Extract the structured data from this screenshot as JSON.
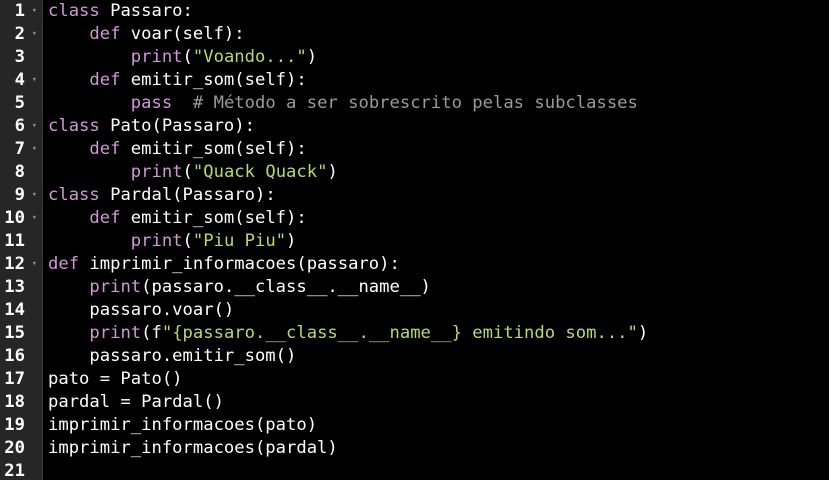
{
  "editor": {
    "colors": {
      "background": "#000000",
      "gutter": "#262626",
      "keyword": "#d197d9",
      "string": "#b8d96b",
      "comment": "#9a9a9a",
      "text": "#ffffff"
    },
    "fold_icon": "chevron-down-icon",
    "lines": [
      {
        "number": "1",
        "fold": true,
        "tokens": [
          {
            "t": "kw",
            "v": "class"
          },
          {
            "t": "plain",
            "v": " Passaro:"
          }
        ]
      },
      {
        "number": "2",
        "fold": true,
        "tokens": [
          {
            "t": "plain",
            "v": "    "
          },
          {
            "t": "kw",
            "v": "def"
          },
          {
            "t": "plain",
            "v": " voar(self):"
          }
        ]
      },
      {
        "number": "3",
        "fold": false,
        "tokens": [
          {
            "t": "plain",
            "v": "        "
          },
          {
            "t": "builtin",
            "v": "print"
          },
          {
            "t": "plain",
            "v": "("
          },
          {
            "t": "str",
            "v": "\"Voando...\""
          },
          {
            "t": "plain",
            "v": ")"
          }
        ]
      },
      {
        "number": "4",
        "fold": true,
        "tokens": [
          {
            "t": "plain",
            "v": "    "
          },
          {
            "t": "kw",
            "v": "def"
          },
          {
            "t": "plain",
            "v": " emitir_som(self):"
          }
        ]
      },
      {
        "number": "5",
        "fold": false,
        "tokens": [
          {
            "t": "plain",
            "v": "        "
          },
          {
            "t": "kw",
            "v": "pass"
          },
          {
            "t": "plain",
            "v": "  "
          },
          {
            "t": "comment",
            "v": "# Método a ser sobrescrito pelas subclasses"
          }
        ]
      },
      {
        "number": "6",
        "fold": true,
        "tokens": [
          {
            "t": "kw",
            "v": "class"
          },
          {
            "t": "plain",
            "v": " Pato(Passaro):"
          }
        ]
      },
      {
        "number": "7",
        "fold": true,
        "tokens": [
          {
            "t": "plain",
            "v": "    "
          },
          {
            "t": "kw",
            "v": "def"
          },
          {
            "t": "plain",
            "v": " emitir_som(self):"
          }
        ]
      },
      {
        "number": "8",
        "fold": false,
        "tokens": [
          {
            "t": "plain",
            "v": "        "
          },
          {
            "t": "builtin",
            "v": "print"
          },
          {
            "t": "plain",
            "v": "("
          },
          {
            "t": "str",
            "v": "\"Quack Quack\""
          },
          {
            "t": "plain",
            "v": ")"
          }
        ]
      },
      {
        "number": "9",
        "fold": true,
        "tokens": [
          {
            "t": "kw",
            "v": "class"
          },
          {
            "t": "plain",
            "v": " Pardal(Passaro):"
          }
        ]
      },
      {
        "number": "10",
        "fold": true,
        "tokens": [
          {
            "t": "plain",
            "v": "    "
          },
          {
            "t": "kw",
            "v": "def"
          },
          {
            "t": "plain",
            "v": " emitir_som(self):"
          }
        ]
      },
      {
        "number": "11",
        "fold": false,
        "tokens": [
          {
            "t": "plain",
            "v": "        "
          },
          {
            "t": "builtin",
            "v": "print"
          },
          {
            "t": "plain",
            "v": "("
          },
          {
            "t": "str",
            "v": "\"Piu Piu\""
          },
          {
            "t": "plain",
            "v": ")"
          }
        ]
      },
      {
        "number": "12",
        "fold": true,
        "tokens": [
          {
            "t": "kw",
            "v": "def"
          },
          {
            "t": "plain",
            "v": " imprimir_informacoes(passaro):"
          }
        ]
      },
      {
        "number": "13",
        "fold": false,
        "tokens": [
          {
            "t": "plain",
            "v": "    "
          },
          {
            "t": "builtin",
            "v": "print"
          },
          {
            "t": "plain",
            "v": "(passaro.__class__.__name__)"
          }
        ]
      },
      {
        "number": "14",
        "fold": false,
        "tokens": [
          {
            "t": "plain",
            "v": "    passaro.voar()"
          }
        ]
      },
      {
        "number": "15",
        "fold": false,
        "tokens": [
          {
            "t": "plain",
            "v": "    "
          },
          {
            "t": "builtin",
            "v": "print"
          },
          {
            "t": "plain",
            "v": "(f"
          },
          {
            "t": "str",
            "v": "\"{passaro.__class__.__name__} emitindo som...\""
          },
          {
            "t": "plain",
            "v": ")"
          }
        ]
      },
      {
        "number": "16",
        "fold": false,
        "tokens": [
          {
            "t": "plain",
            "v": "    passaro.emitir_som()"
          }
        ]
      },
      {
        "number": "17",
        "fold": false,
        "tokens": [
          {
            "t": "plain",
            "v": "pato = Pato()"
          }
        ]
      },
      {
        "number": "18",
        "fold": false,
        "tokens": [
          {
            "t": "plain",
            "v": "pardal = Pardal()"
          }
        ]
      },
      {
        "number": "19",
        "fold": false,
        "tokens": [
          {
            "t": "plain",
            "v": "imprimir_informacoes(pato)"
          }
        ]
      },
      {
        "number": "20",
        "fold": false,
        "tokens": [
          {
            "t": "plain",
            "v": "imprimir_informacoes(pardal)"
          }
        ]
      },
      {
        "number": "21",
        "fold": false,
        "tokens": []
      }
    ]
  }
}
